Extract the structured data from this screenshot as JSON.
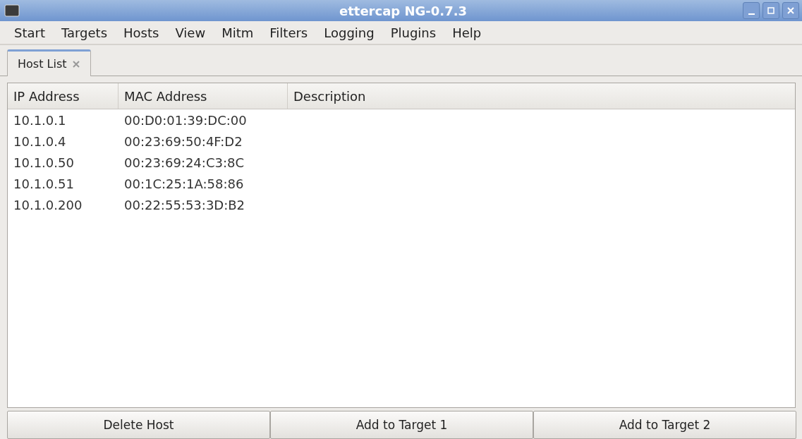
{
  "window": {
    "title": "ettercap NG-0.7.3"
  },
  "menu": [
    "Start",
    "Targets",
    "Hosts",
    "View",
    "Mitm",
    "Filters",
    "Logging",
    "Plugins",
    "Help"
  ],
  "tabs": [
    {
      "label": "Host List",
      "selected": true
    }
  ],
  "table": {
    "columns": [
      "IP Address",
      "MAC Address",
      "Description"
    ],
    "rows": [
      [
        "10.1.0.1",
        "00:D0:01:39:DC:00",
        ""
      ],
      [
        "10.1.0.4",
        "00:23:69:50:4F:D2",
        ""
      ],
      [
        "10.1.0.50",
        "00:23:69:24:C3:8C",
        ""
      ],
      [
        "10.1.0.51",
        "00:1C:25:1A:58:86",
        ""
      ],
      [
        "10.1.0.200",
        "00:22:55:53:3D:B2",
        ""
      ]
    ]
  },
  "buttons": [
    "Delete Host",
    "Add to Target 1",
    "Add to Target 2"
  ]
}
